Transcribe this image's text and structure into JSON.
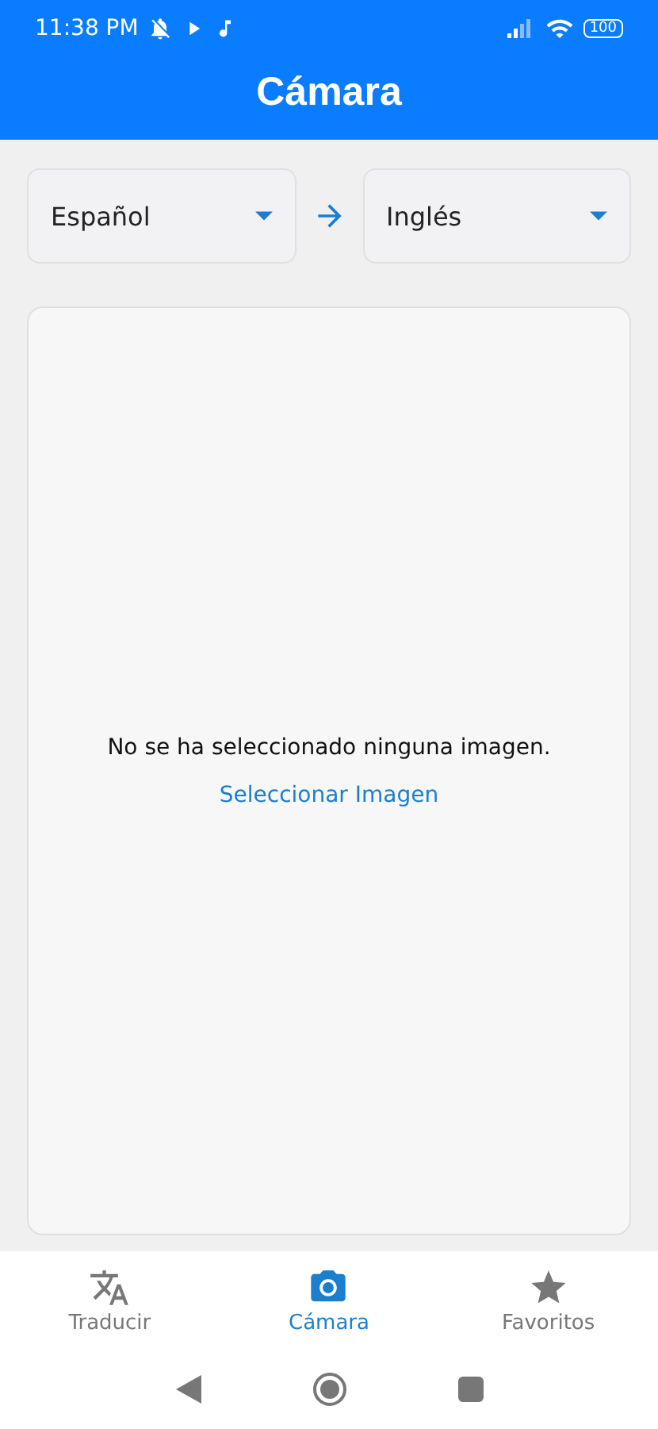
{
  "status_bar": {
    "time": "11:38 PM",
    "battery": "100"
  },
  "header": {
    "title": "Cámara"
  },
  "languages": {
    "source": "Español",
    "target": "Inglés"
  },
  "image_panel": {
    "message": "No se ha seleccionado ninguna imagen.",
    "action": "Seleccionar Imagen"
  },
  "tabs": [
    {
      "label": "Traducir",
      "kind": "translate",
      "selected": false
    },
    {
      "label": "Cámara",
      "kind": "camera",
      "selected": true
    },
    {
      "label": "Favoritos",
      "kind": "star",
      "selected": false
    }
  ]
}
